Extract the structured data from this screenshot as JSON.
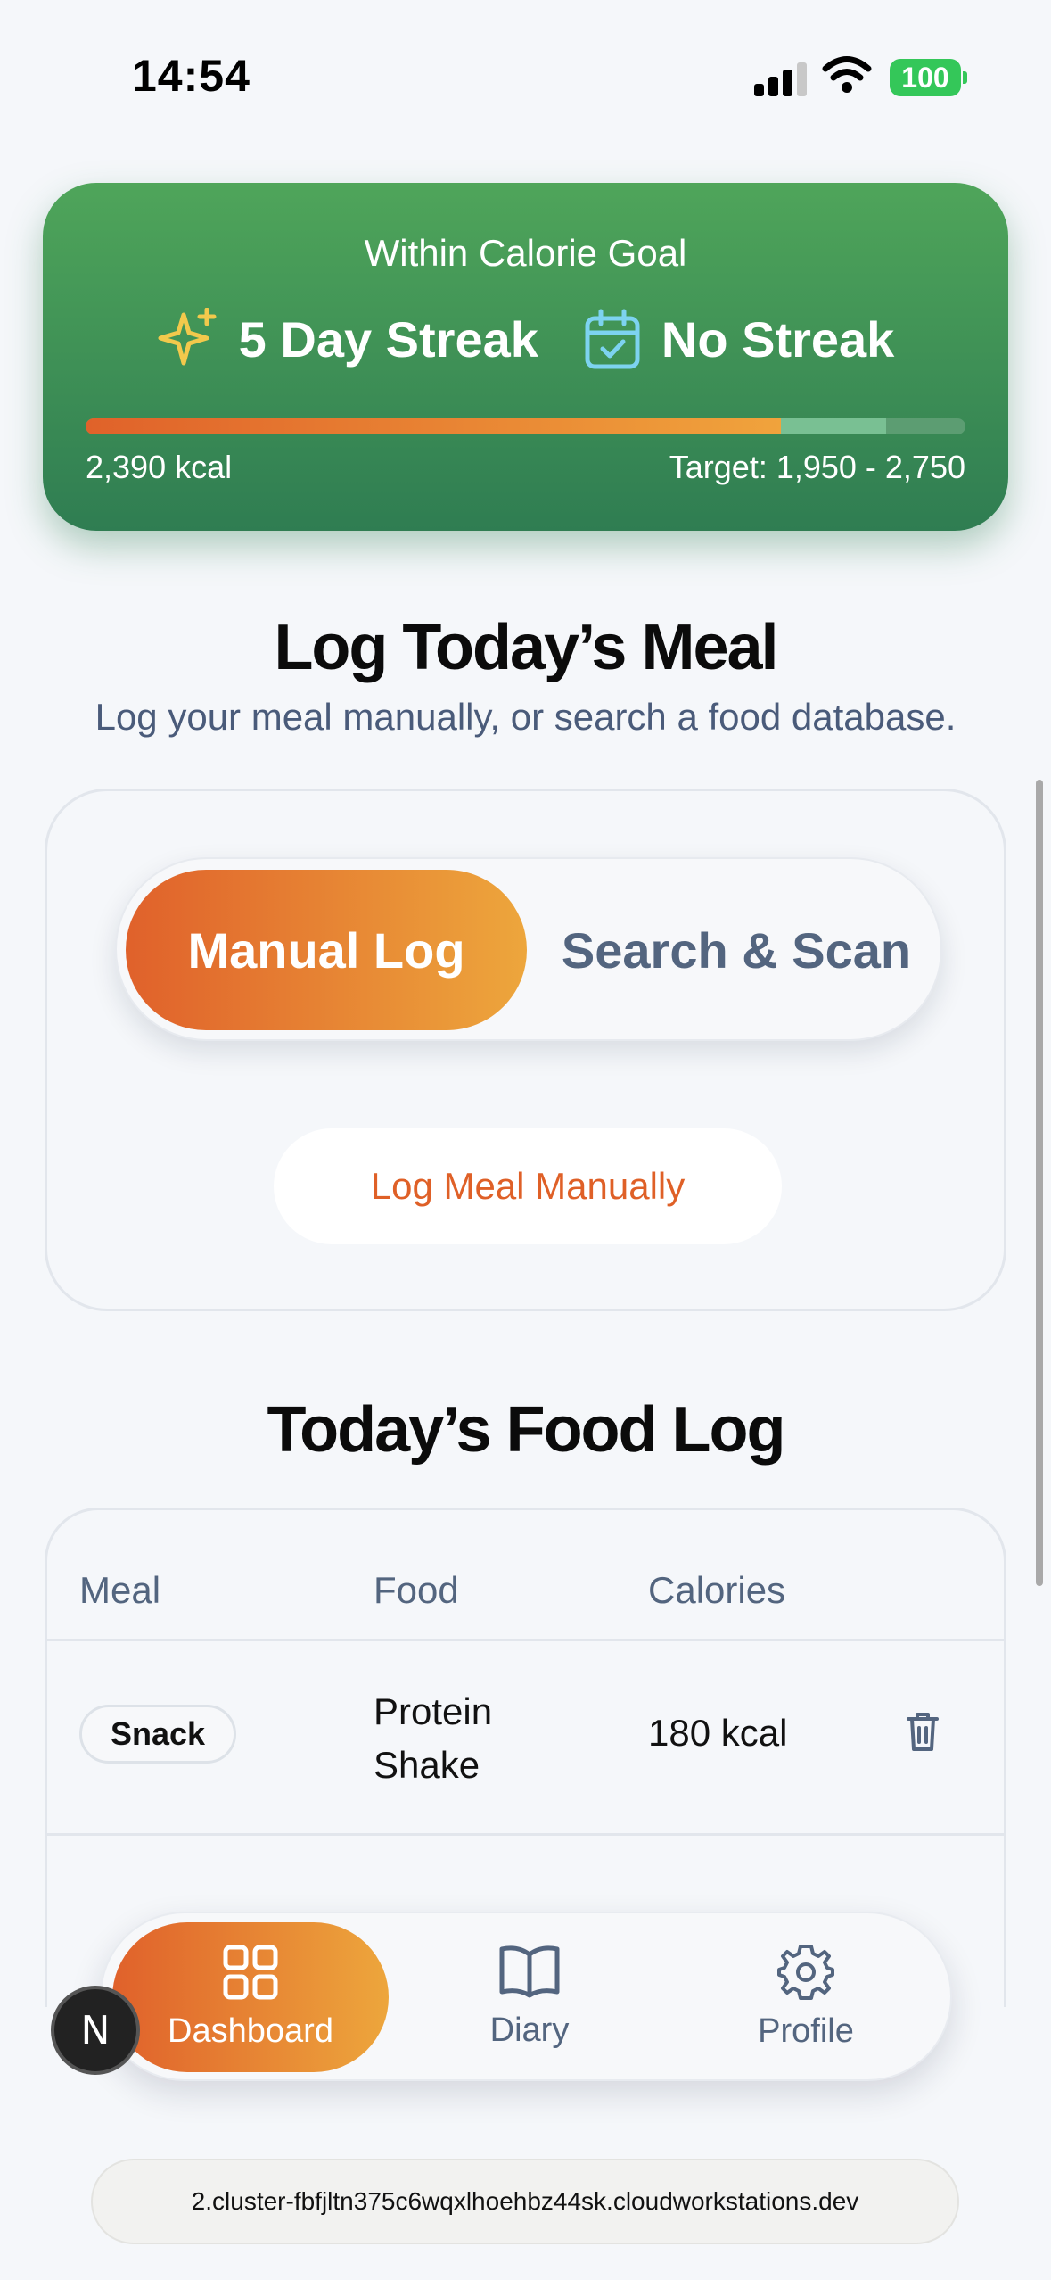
{
  "status_bar": {
    "time": "14:54",
    "battery": "100"
  },
  "streak": {
    "title": "Within Calorie Goal",
    "streak1": "5 Day Streak",
    "streak2": "No Streak",
    "kcal": "2,390 kcal",
    "target": "Target: 1,950 - 2,750",
    "progress_fraction": 0.79,
    "colors": {
      "card": "#3f9456",
      "fill": "#e9943a"
    }
  },
  "log": {
    "title": "Log Today’s Meal",
    "subtitle": "Log your meal manually, or search a food database.",
    "tab_manual": "Manual Log",
    "tab_search": "Search & Scan",
    "manual_button": "Log Meal Manually"
  },
  "food_log": {
    "title": "Today’s Food Log",
    "headers": [
      "Meal",
      "Food",
      "Calories"
    ],
    "rows": [
      {
        "meal": "Snack",
        "food": "Protein Shake",
        "calories": "180 kcal"
      }
    ]
  },
  "nav": {
    "items": [
      {
        "label": "Dashboard",
        "icon": "grid-icon"
      },
      {
        "label": "Diary",
        "icon": "book-icon"
      },
      {
        "label": "Profile",
        "icon": "gear-icon"
      }
    ]
  },
  "dev_badge": "N",
  "url": "2.cluster-fbfjltn375c6wqxlhoehbz44sk.cloudworkstations.dev"
}
